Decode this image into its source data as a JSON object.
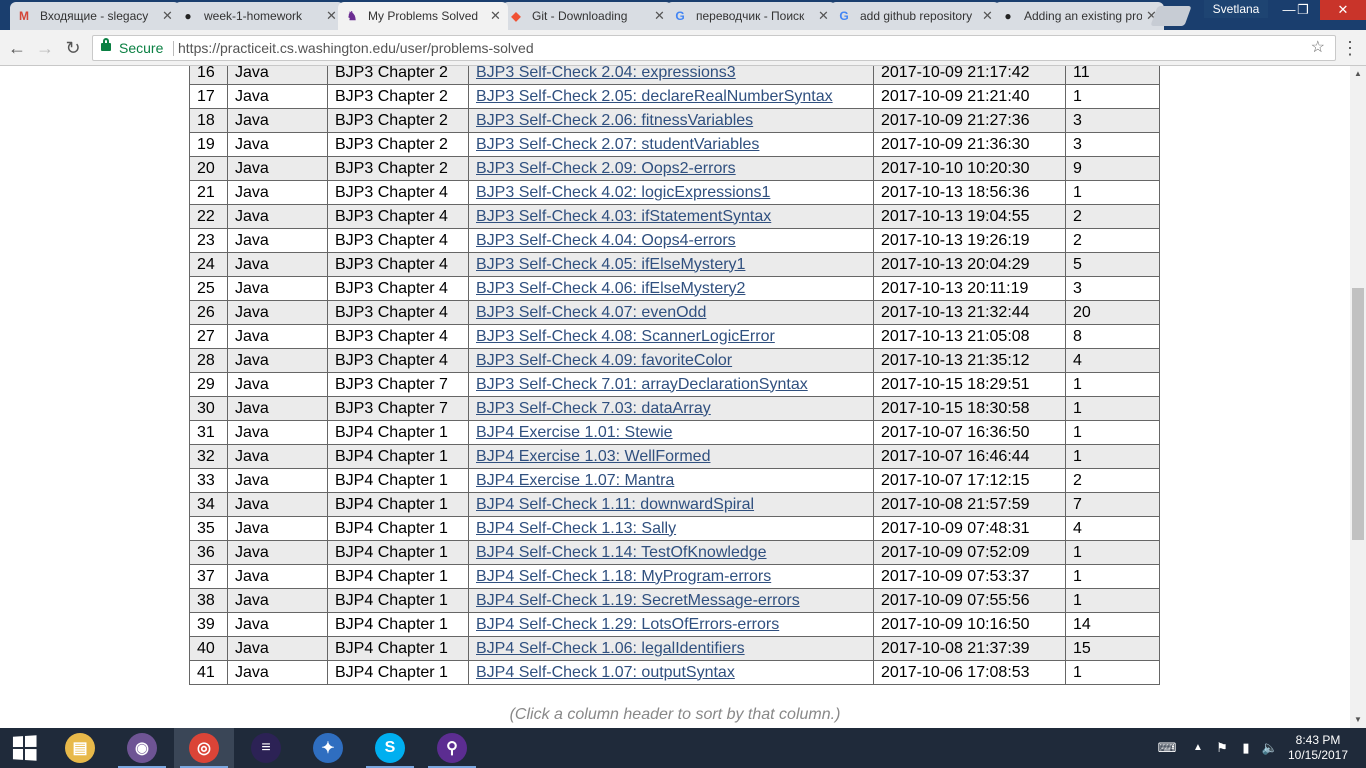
{
  "window": {
    "user": "Svetlana",
    "minimize": "—",
    "maximize": "❐",
    "close": "✕"
  },
  "tabs": [
    {
      "title": "Входящие - slegacy",
      "icon": "gmail-icon",
      "color": "#d44638",
      "glyph": "M"
    },
    {
      "title": "week-1-homework",
      "icon": "github-icon",
      "color": "#222222",
      "glyph": "●"
    },
    {
      "title": "My Problems Solved",
      "icon": "practiceit-icon",
      "color": "#6a2c91",
      "glyph": "♞"
    },
    {
      "title": "Git - Downloading",
      "icon": "git-icon",
      "color": "#f05133",
      "glyph": "◆"
    },
    {
      "title": "переводчик - Поиск",
      "icon": "google-icon",
      "color": "#4285f4",
      "glyph": "G"
    },
    {
      "title": "add github repository",
      "icon": "google-icon",
      "color": "#4285f4",
      "glyph": "G"
    },
    {
      "title": "Adding an existing project",
      "icon": "github-icon",
      "color": "#222222",
      "glyph": "●"
    }
  ],
  "address_bar": {
    "secure_label": "Secure",
    "url": "https://practiceit.cs.washington.edu/user/problems-solved"
  },
  "table": {
    "rows": [
      {
        "num": "16",
        "lang": "Java",
        "book": "BJP3 Chapter 2",
        "problem": "BJP3 Self-Check 2.04: expressions3",
        "date": "2017-10-09 21:17:42",
        "tries": "11"
      },
      {
        "num": "17",
        "lang": "Java",
        "book": "BJP3 Chapter 2",
        "problem": "BJP3 Self-Check 2.05: declareRealNumberSyntax",
        "date": "2017-10-09 21:21:40",
        "tries": "1"
      },
      {
        "num": "18",
        "lang": "Java",
        "book": "BJP3 Chapter 2",
        "problem": "BJP3 Self-Check 2.06: fitnessVariables",
        "date": "2017-10-09 21:27:36",
        "tries": "3"
      },
      {
        "num": "19",
        "lang": "Java",
        "book": "BJP3 Chapter 2",
        "problem": "BJP3 Self-Check 2.07: studentVariables",
        "date": "2017-10-09 21:36:30",
        "tries": "3"
      },
      {
        "num": "20",
        "lang": "Java",
        "book": "BJP3 Chapter 2",
        "problem": "BJP3 Self-Check 2.09: Oops2-errors",
        "date": "2017-10-10 10:20:30",
        "tries": "9"
      },
      {
        "num": "21",
        "lang": "Java",
        "book": "BJP3 Chapter 4",
        "problem": "BJP3 Self-Check 4.02: logicExpressions1",
        "date": "2017-10-13 18:56:36",
        "tries": "1"
      },
      {
        "num": "22",
        "lang": "Java",
        "book": "BJP3 Chapter 4",
        "problem": "BJP3 Self-Check 4.03: ifStatementSyntax",
        "date": "2017-10-13 19:04:55",
        "tries": "2"
      },
      {
        "num": "23",
        "lang": "Java",
        "book": "BJP3 Chapter 4",
        "problem": "BJP3 Self-Check 4.04: Oops4-errors",
        "date": "2017-10-13 19:26:19",
        "tries": "2"
      },
      {
        "num": "24",
        "lang": "Java",
        "book": "BJP3 Chapter 4",
        "problem": "BJP3 Self-Check 4.05: ifElseMystery1",
        "date": "2017-10-13 20:04:29",
        "tries": "5"
      },
      {
        "num": "25",
        "lang": "Java",
        "book": "BJP3 Chapter 4",
        "problem": "BJP3 Self-Check 4.06: ifElseMystery2",
        "date": "2017-10-13 20:11:19",
        "tries": "3"
      },
      {
        "num": "26",
        "lang": "Java",
        "book": "BJP3 Chapter 4",
        "problem": "BJP3 Self-Check 4.07: evenOdd",
        "date": "2017-10-13 21:32:44",
        "tries": "20"
      },
      {
        "num": "27",
        "lang": "Java",
        "book": "BJP3 Chapter 4",
        "problem": "BJP3 Self-Check 4.08: ScannerLogicError",
        "date": "2017-10-13 21:05:08",
        "tries": "8"
      },
      {
        "num": "28",
        "lang": "Java",
        "book": "BJP3 Chapter 4",
        "problem": "BJP3 Self-Check 4.09: favoriteColor",
        "date": "2017-10-13 21:35:12",
        "tries": "4"
      },
      {
        "num": "29",
        "lang": "Java",
        "book": "BJP3 Chapter 7",
        "problem": "BJP3 Self-Check 7.01: arrayDeclarationSyntax",
        "date": "2017-10-15 18:29:51",
        "tries": "1"
      },
      {
        "num": "30",
        "lang": "Java",
        "book": "BJP3 Chapter 7",
        "problem": "BJP3 Self-Check 7.03: dataArray",
        "date": "2017-10-15 18:30:58",
        "tries": "1"
      },
      {
        "num": "31",
        "lang": "Java",
        "book": "BJP4 Chapter 1",
        "problem": "BJP4 Exercise 1.01: Stewie",
        "date": "2017-10-07 16:36:50",
        "tries": "1"
      },
      {
        "num": "32",
        "lang": "Java",
        "book": "BJP4 Chapter 1",
        "problem": "BJP4 Exercise 1.03: WellFormed",
        "date": "2017-10-07 16:46:44",
        "tries": "1"
      },
      {
        "num": "33",
        "lang": "Java",
        "book": "BJP4 Chapter 1",
        "problem": "BJP4 Exercise 1.07: Mantra",
        "date": "2017-10-07 17:12:15",
        "tries": "2"
      },
      {
        "num": "34",
        "lang": "Java",
        "book": "BJP4 Chapter 1",
        "problem": "BJP4 Self-Check 1.11: downwardSpiral",
        "date": "2017-10-08 21:57:59",
        "tries": "7"
      },
      {
        "num": "35",
        "lang": "Java",
        "book": "BJP4 Chapter 1",
        "problem": "BJP4 Self-Check 1.13: Sally",
        "date": "2017-10-09 07:48:31",
        "tries": "4"
      },
      {
        "num": "36",
        "lang": "Java",
        "book": "BJP4 Chapter 1",
        "problem": "BJP4 Self-Check 1.14: TestOfKnowledge",
        "date": "2017-10-09 07:52:09",
        "tries": "1"
      },
      {
        "num": "37",
        "lang": "Java",
        "book": "BJP4 Chapter 1",
        "problem": "BJP4 Self-Check 1.18: MyProgram-errors",
        "date": "2017-10-09 07:53:37",
        "tries": "1"
      },
      {
        "num": "38",
        "lang": "Java",
        "book": "BJP4 Chapter 1",
        "problem": "BJP4 Self-Check 1.19: SecretMessage-errors",
        "date": "2017-10-09 07:55:56",
        "tries": "1"
      },
      {
        "num": "39",
        "lang": "Java",
        "book": "BJP4 Chapter 1",
        "problem": "BJP4 Self-Check 1.29: LotsOfErrors-errors",
        "date": "2017-10-09 10:16:50",
        "tries": "14"
      },
      {
        "num": "40",
        "lang": "Java",
        "book": "BJP4 Chapter 1",
        "problem": "BJP4 Self-Check 1.06: legalIdentifiers",
        "date": "2017-10-08 21:37:39",
        "tries": "15"
      },
      {
        "num": "41",
        "lang": "Java",
        "book": "BJP4 Chapter 1",
        "problem": "BJP4 Self-Check 1.07: outputSyntax",
        "date": "2017-10-06 17:08:53",
        "tries": "1"
      }
    ],
    "sort_hint": "(Click a column header to sort by that column.)"
  },
  "taskbar": {
    "apps": [
      {
        "name": "file-explorer-icon",
        "color": "#e8b94a",
        "glyph": "▤"
      },
      {
        "name": "github-desktop-icon",
        "color": "#6e5494",
        "glyph": "◉"
      },
      {
        "name": "chrome-icon",
        "color": "#db4437",
        "glyph": "◎"
      },
      {
        "name": "eclipse-icon",
        "color": "#2c2255",
        "glyph": "≡"
      },
      {
        "name": "sourcetree-icon",
        "color": "#2f6ec0",
        "glyph": "✦"
      },
      {
        "name": "skype-icon",
        "color": "#00aff0",
        "glyph": "S"
      },
      {
        "name": "search-app-icon",
        "color": "#5c2d91",
        "glyph": "⚲"
      }
    ],
    "time": "8:43 PM",
    "date": "10/15/2017"
  }
}
